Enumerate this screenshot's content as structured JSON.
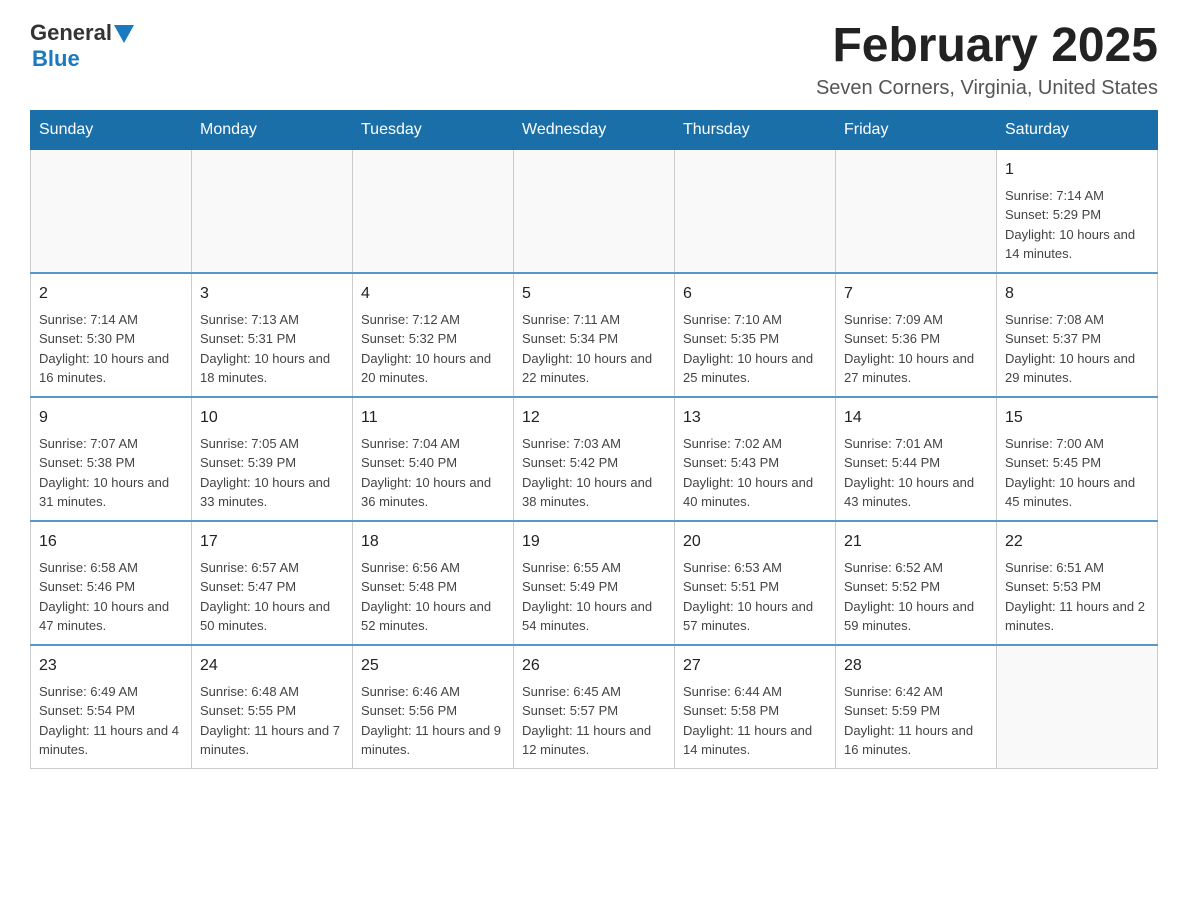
{
  "header": {
    "logo_general": "General",
    "logo_blue": "Blue",
    "month_title": "February 2025",
    "location": "Seven Corners, Virginia, United States"
  },
  "weekdays": [
    "Sunday",
    "Monday",
    "Tuesday",
    "Wednesday",
    "Thursday",
    "Friday",
    "Saturday"
  ],
  "weeks": [
    [
      {
        "day": "",
        "info": ""
      },
      {
        "day": "",
        "info": ""
      },
      {
        "day": "",
        "info": ""
      },
      {
        "day": "",
        "info": ""
      },
      {
        "day": "",
        "info": ""
      },
      {
        "day": "",
        "info": ""
      },
      {
        "day": "1",
        "info": "Sunrise: 7:14 AM\nSunset: 5:29 PM\nDaylight: 10 hours and 14 minutes."
      }
    ],
    [
      {
        "day": "2",
        "info": "Sunrise: 7:14 AM\nSunset: 5:30 PM\nDaylight: 10 hours and 16 minutes."
      },
      {
        "day": "3",
        "info": "Sunrise: 7:13 AM\nSunset: 5:31 PM\nDaylight: 10 hours and 18 minutes."
      },
      {
        "day": "4",
        "info": "Sunrise: 7:12 AM\nSunset: 5:32 PM\nDaylight: 10 hours and 20 minutes."
      },
      {
        "day": "5",
        "info": "Sunrise: 7:11 AM\nSunset: 5:34 PM\nDaylight: 10 hours and 22 minutes."
      },
      {
        "day": "6",
        "info": "Sunrise: 7:10 AM\nSunset: 5:35 PM\nDaylight: 10 hours and 25 minutes."
      },
      {
        "day": "7",
        "info": "Sunrise: 7:09 AM\nSunset: 5:36 PM\nDaylight: 10 hours and 27 minutes."
      },
      {
        "day": "8",
        "info": "Sunrise: 7:08 AM\nSunset: 5:37 PM\nDaylight: 10 hours and 29 minutes."
      }
    ],
    [
      {
        "day": "9",
        "info": "Sunrise: 7:07 AM\nSunset: 5:38 PM\nDaylight: 10 hours and 31 minutes."
      },
      {
        "day": "10",
        "info": "Sunrise: 7:05 AM\nSunset: 5:39 PM\nDaylight: 10 hours and 33 minutes."
      },
      {
        "day": "11",
        "info": "Sunrise: 7:04 AM\nSunset: 5:40 PM\nDaylight: 10 hours and 36 minutes."
      },
      {
        "day": "12",
        "info": "Sunrise: 7:03 AM\nSunset: 5:42 PM\nDaylight: 10 hours and 38 minutes."
      },
      {
        "day": "13",
        "info": "Sunrise: 7:02 AM\nSunset: 5:43 PM\nDaylight: 10 hours and 40 minutes."
      },
      {
        "day": "14",
        "info": "Sunrise: 7:01 AM\nSunset: 5:44 PM\nDaylight: 10 hours and 43 minutes."
      },
      {
        "day": "15",
        "info": "Sunrise: 7:00 AM\nSunset: 5:45 PM\nDaylight: 10 hours and 45 minutes."
      }
    ],
    [
      {
        "day": "16",
        "info": "Sunrise: 6:58 AM\nSunset: 5:46 PM\nDaylight: 10 hours and 47 minutes."
      },
      {
        "day": "17",
        "info": "Sunrise: 6:57 AM\nSunset: 5:47 PM\nDaylight: 10 hours and 50 minutes."
      },
      {
        "day": "18",
        "info": "Sunrise: 6:56 AM\nSunset: 5:48 PM\nDaylight: 10 hours and 52 minutes."
      },
      {
        "day": "19",
        "info": "Sunrise: 6:55 AM\nSunset: 5:49 PM\nDaylight: 10 hours and 54 minutes."
      },
      {
        "day": "20",
        "info": "Sunrise: 6:53 AM\nSunset: 5:51 PM\nDaylight: 10 hours and 57 minutes."
      },
      {
        "day": "21",
        "info": "Sunrise: 6:52 AM\nSunset: 5:52 PM\nDaylight: 10 hours and 59 minutes."
      },
      {
        "day": "22",
        "info": "Sunrise: 6:51 AM\nSunset: 5:53 PM\nDaylight: 11 hours and 2 minutes."
      }
    ],
    [
      {
        "day": "23",
        "info": "Sunrise: 6:49 AM\nSunset: 5:54 PM\nDaylight: 11 hours and 4 minutes."
      },
      {
        "day": "24",
        "info": "Sunrise: 6:48 AM\nSunset: 5:55 PM\nDaylight: 11 hours and 7 minutes."
      },
      {
        "day": "25",
        "info": "Sunrise: 6:46 AM\nSunset: 5:56 PM\nDaylight: 11 hours and 9 minutes."
      },
      {
        "day": "26",
        "info": "Sunrise: 6:45 AM\nSunset: 5:57 PM\nDaylight: 11 hours and 12 minutes."
      },
      {
        "day": "27",
        "info": "Sunrise: 6:44 AM\nSunset: 5:58 PM\nDaylight: 11 hours and 14 minutes."
      },
      {
        "day": "28",
        "info": "Sunrise: 6:42 AM\nSunset: 5:59 PM\nDaylight: 11 hours and 16 minutes."
      },
      {
        "day": "",
        "info": ""
      }
    ]
  ]
}
